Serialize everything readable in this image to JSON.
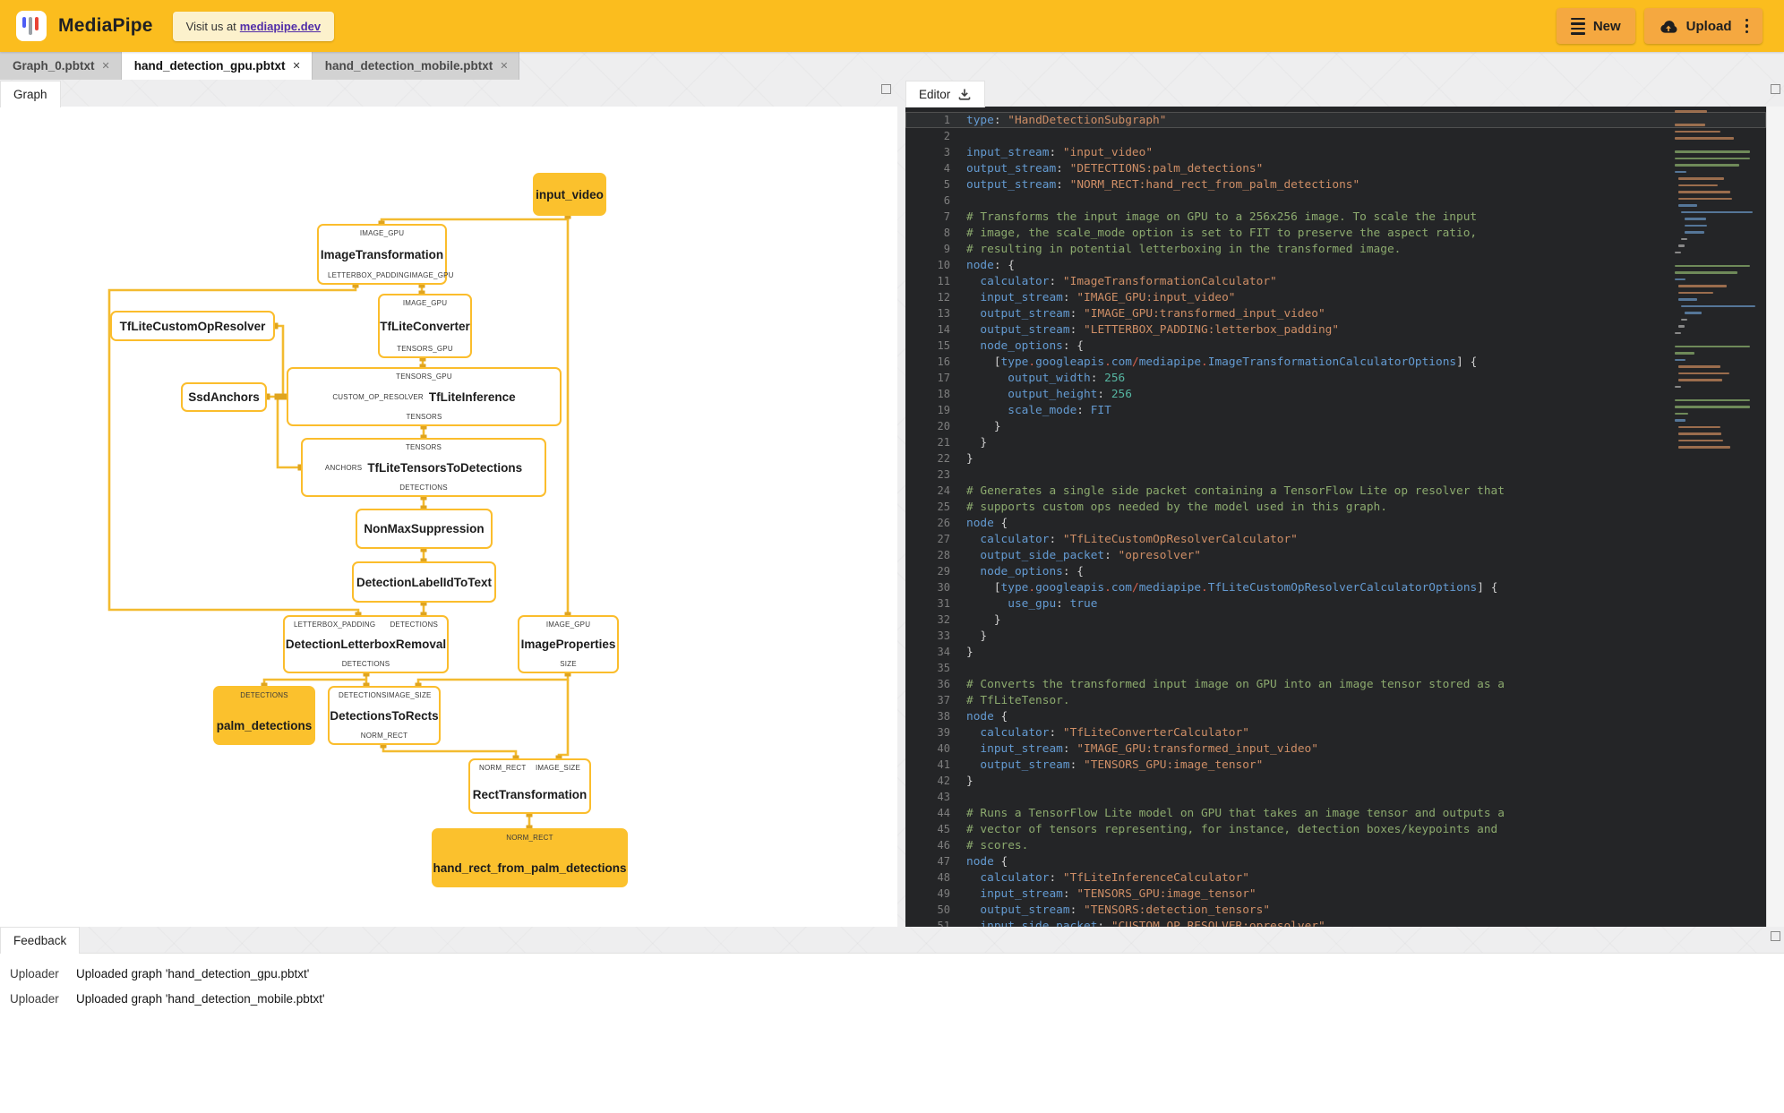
{
  "header": {
    "app_name": "MediaPipe",
    "visit_prefix": "Visit us at",
    "visit_link": "mediapipe.dev",
    "new_label": "New",
    "upload_label": "Upload"
  },
  "icons": {
    "close": "✕"
  },
  "file_tabs": [
    {
      "label": "Graph_0.pbtxt"
    },
    {
      "label": "hand_detection_gpu.pbtxt"
    },
    {
      "label": "hand_detection_mobile.pbtxt"
    }
  ],
  "panels": {
    "graph_tab": "Graph",
    "editor_tab": "Editor",
    "feedback_tab": "Feedback"
  },
  "colors": {
    "header": "#FBBD1E",
    "button": "#F5A840",
    "node_border": "#FBBD2C",
    "node_fill": "#FBC12D",
    "edge": "#F3BB30",
    "editor_bg": "#242527"
  },
  "graph": {
    "nodes": {
      "input_video": {
        "title": "input_video"
      },
      "image_transformation": {
        "title": "ImageTransformation",
        "top_ports": [
          "IMAGE_GPU"
        ],
        "bottom_ports": [
          "LETTERBOX_PADDING",
          "IMAGE_GPU"
        ]
      },
      "tflite_converter": {
        "title": "TfLiteConverter",
        "top_ports": [
          "IMAGE_GPU"
        ],
        "bottom_ports": [
          "TENSORS_GPU"
        ]
      },
      "tflite_custom_op_resolver": {
        "title": "TfLiteCustomOpResolver"
      },
      "ssd_anchors": {
        "title": "SsdAnchors"
      },
      "tflite_inference": {
        "title": "TfLiteInference",
        "top_ports": [
          "TENSORS_GPU"
        ],
        "left_port": "CUSTOM_OP_RESOLVER",
        "bottom_ports": [
          "TENSORS"
        ]
      },
      "tflite_tensors_to_detections": {
        "title": "TfLiteTensorsToDetections",
        "top_ports": [
          "TENSORS"
        ],
        "left_port": "ANCHORS",
        "bottom_ports": [
          "DETECTIONS"
        ]
      },
      "non_max_suppression": {
        "title": "NonMaxSuppression"
      },
      "detection_label_id_to_text": {
        "title": "DetectionLabelIdToText"
      },
      "detection_letterbox_removal": {
        "title": "DetectionLetterboxRemoval",
        "top_ports": [
          "LETTERBOX_PADDING",
          "DETECTIONS"
        ],
        "bottom_ports": [
          "DETECTIONS"
        ]
      },
      "image_properties": {
        "title": "ImageProperties",
        "top_ports": [
          "IMAGE_GPU"
        ],
        "bottom_ports": [
          "SIZE"
        ]
      },
      "palm_detections": {
        "title": "palm_detections",
        "top_ports": [
          "DETECTIONS"
        ]
      },
      "detections_to_rects": {
        "title": "DetectionsToRects",
        "top_ports": [
          "DETECTIONS",
          "IMAGE_SIZE"
        ],
        "bottom_ports": [
          "NORM_RECT"
        ]
      },
      "rect_transformation": {
        "title": "RectTransformation",
        "top_ports": [
          "NORM_RECT",
          "IMAGE_SIZE"
        ]
      },
      "hand_rect": {
        "title": "hand_rect_from_palm_detections",
        "top_ports": [
          "NORM_RECT"
        ]
      }
    }
  },
  "editor": {
    "current_line": 1,
    "lines": [
      "type: \"HandDetectionSubgraph\"",
      "",
      "input_stream: \"input_video\"",
      "output_stream: \"DETECTIONS:palm_detections\"",
      "output_stream: \"NORM_RECT:hand_rect_from_palm_detections\"",
      "",
      "# Transforms the input image on GPU to a 256x256 image. To scale the input",
      "# image, the scale_mode option is set to FIT to preserve the aspect ratio,",
      "# resulting in potential letterboxing in the transformed image.",
      "node: {",
      "  calculator: \"ImageTransformationCalculator\"",
      "  input_stream: \"IMAGE_GPU:input_video\"",
      "  output_stream: \"IMAGE_GPU:transformed_input_video\"",
      "  output_stream: \"LETTERBOX_PADDING:letterbox_padding\"",
      "  node_options: {",
      "    [type.googleapis.com/mediapipe.ImageTransformationCalculatorOptions] {",
      "      output_width: 256",
      "      output_height: 256",
      "      scale_mode: FIT",
      "    }",
      "  }",
      "}",
      "",
      "# Generates a single side packet containing a TensorFlow Lite op resolver that",
      "# supports custom ops needed by the model used in this graph.",
      "node {",
      "  calculator: \"TfLiteCustomOpResolverCalculator\"",
      "  output_side_packet: \"opresolver\"",
      "  node_options: {",
      "    [type.googleapis.com/mediapipe.TfLiteCustomOpResolverCalculatorOptions] {",
      "      use_gpu: true",
      "    }",
      "  }",
      "}",
      "",
      "# Converts the transformed input image on GPU into an image tensor stored as a",
      "# TfLiteTensor.",
      "node {",
      "  calculator: \"TfLiteConverterCalculator\"",
      "  input_stream: \"IMAGE_GPU:transformed_input_video\"",
      "  output_stream: \"TENSORS_GPU:image_tensor\"",
      "}",
      "",
      "# Runs a TensorFlow Lite model on GPU that takes an image tensor and outputs a",
      "# vector of tensors representing, for instance, detection boxes/keypoints and",
      "# scores.",
      "node {",
      "  calculator: \"TfLiteInferenceCalculator\"",
      "  input_stream: \"TENSORS_GPU:image_tensor\"",
      "  output_stream: \"TENSORS:detection_tensors\"",
      "  input_side_packet: \"CUSTOM_OP_RESOLVER:opresolver\""
    ]
  },
  "feedback": {
    "rows": [
      {
        "source": "Uploader",
        "message": "Uploaded graph 'hand_detection_gpu.pbtxt'"
      },
      {
        "source": "Uploader",
        "message": "Uploaded graph 'hand_detection_mobile.pbtxt'"
      }
    ]
  }
}
